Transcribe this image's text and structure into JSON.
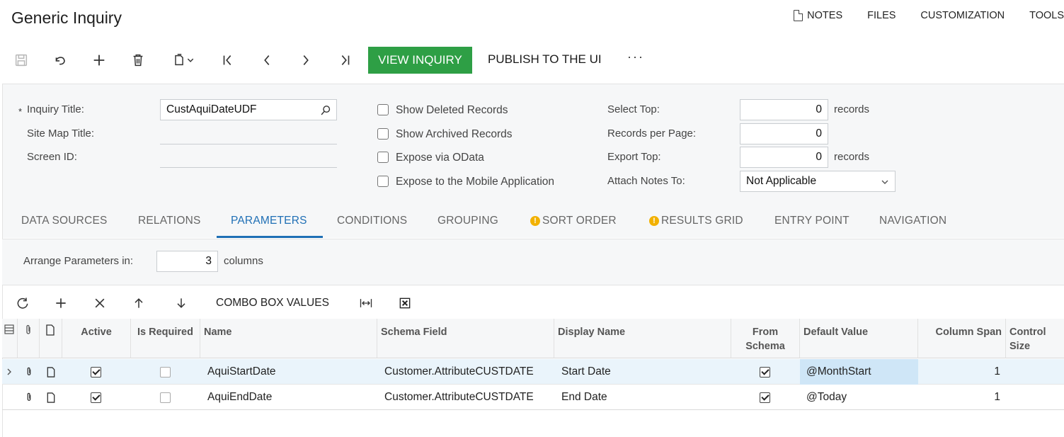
{
  "header": {
    "title": "Generic Inquiry",
    "links": [
      "NOTES",
      "FILES",
      "CUSTOMIZATION",
      "TOOLS"
    ]
  },
  "toolbar": {
    "view_inquiry": "VIEW INQUIRY",
    "publish": "PUBLISH TO THE UI",
    "more": "···",
    "icons": [
      "save-icon",
      "undo-icon",
      "add-icon",
      "delete-icon",
      "copy-paste-icon",
      "first-record-icon",
      "previous-record-icon",
      "next-record-icon",
      "last-record-icon"
    ]
  },
  "form": {
    "required_mark": "*",
    "inquiry_title_label": "Inquiry Title:",
    "inquiry_title_value": "CustAquiDateUDF",
    "site_map_title_label": "Site Map Title:",
    "screen_id_label": "Screen ID:",
    "show_deleted_label": "Show Deleted Records",
    "show_archived_label": "Show Archived Records",
    "expose_odata_label": "Expose via OData",
    "expose_mobile_label": "Expose to the Mobile Application",
    "select_top_label": "Select Top:",
    "select_top_value": "0",
    "records_per_page_label": "Records per Page:",
    "records_per_page_value": "0",
    "export_top_label": "Export Top:",
    "export_top_value": "0",
    "records_unit": "records",
    "attach_notes_label": "Attach Notes To:",
    "attach_notes_value": "Not Applicable"
  },
  "tabs": [
    {
      "label": "DATA SOURCES",
      "active": false,
      "warning": false
    },
    {
      "label": "RELATIONS",
      "active": false,
      "warning": false
    },
    {
      "label": "PARAMETERS",
      "active": true,
      "warning": false
    },
    {
      "label": "CONDITIONS",
      "active": false,
      "warning": false
    },
    {
      "label": "GROUPING",
      "active": false,
      "warning": false
    },
    {
      "label": "SORT ORDER",
      "active": false,
      "warning": true
    },
    {
      "label": "RESULTS GRID",
      "active": false,
      "warning": true
    },
    {
      "label": "ENTRY POINT",
      "active": false,
      "warning": false
    },
    {
      "label": "NAVIGATION",
      "active": false,
      "warning": false
    }
  ],
  "arrange": {
    "label": "Arrange Parameters in:",
    "value": "3",
    "unit": "columns"
  },
  "grid_toolbar": {
    "combo_box_values": "COMBO BOX VALUES",
    "icons": [
      "refresh-icon",
      "add-row-icon",
      "delete-row-icon",
      "move-up-icon",
      "move-down-icon",
      "fit-columns-icon",
      "export-excel-icon"
    ]
  },
  "grid": {
    "columns": [
      "Active",
      "Is Required",
      "Name",
      "Schema Field",
      "Display Name",
      "From Schema",
      "Default Value",
      "Column Span",
      "Control Size"
    ],
    "rows": [
      {
        "active": true,
        "is_required": false,
        "name": "AquiStartDate",
        "schema_field": "Customer.AttributeCUSTDATE",
        "display_name": "Start Date",
        "from_schema": true,
        "default_value": "@MonthStart",
        "column_span": "1",
        "control_size": ""
      },
      {
        "active": true,
        "is_required": false,
        "name": "AquiEndDate",
        "schema_field": "Customer.AttributeCUSTDATE",
        "display_name": "End Date",
        "from_schema": true,
        "default_value": "@Today",
        "column_span": "1",
        "control_size": ""
      }
    ]
  },
  "colors": {
    "accent": "#1f6fb5",
    "primary_button": "#2e9f45",
    "warning": "#f2b100",
    "panel_bg": "#f6f7f8",
    "selected_row": "#eaf4fb"
  }
}
